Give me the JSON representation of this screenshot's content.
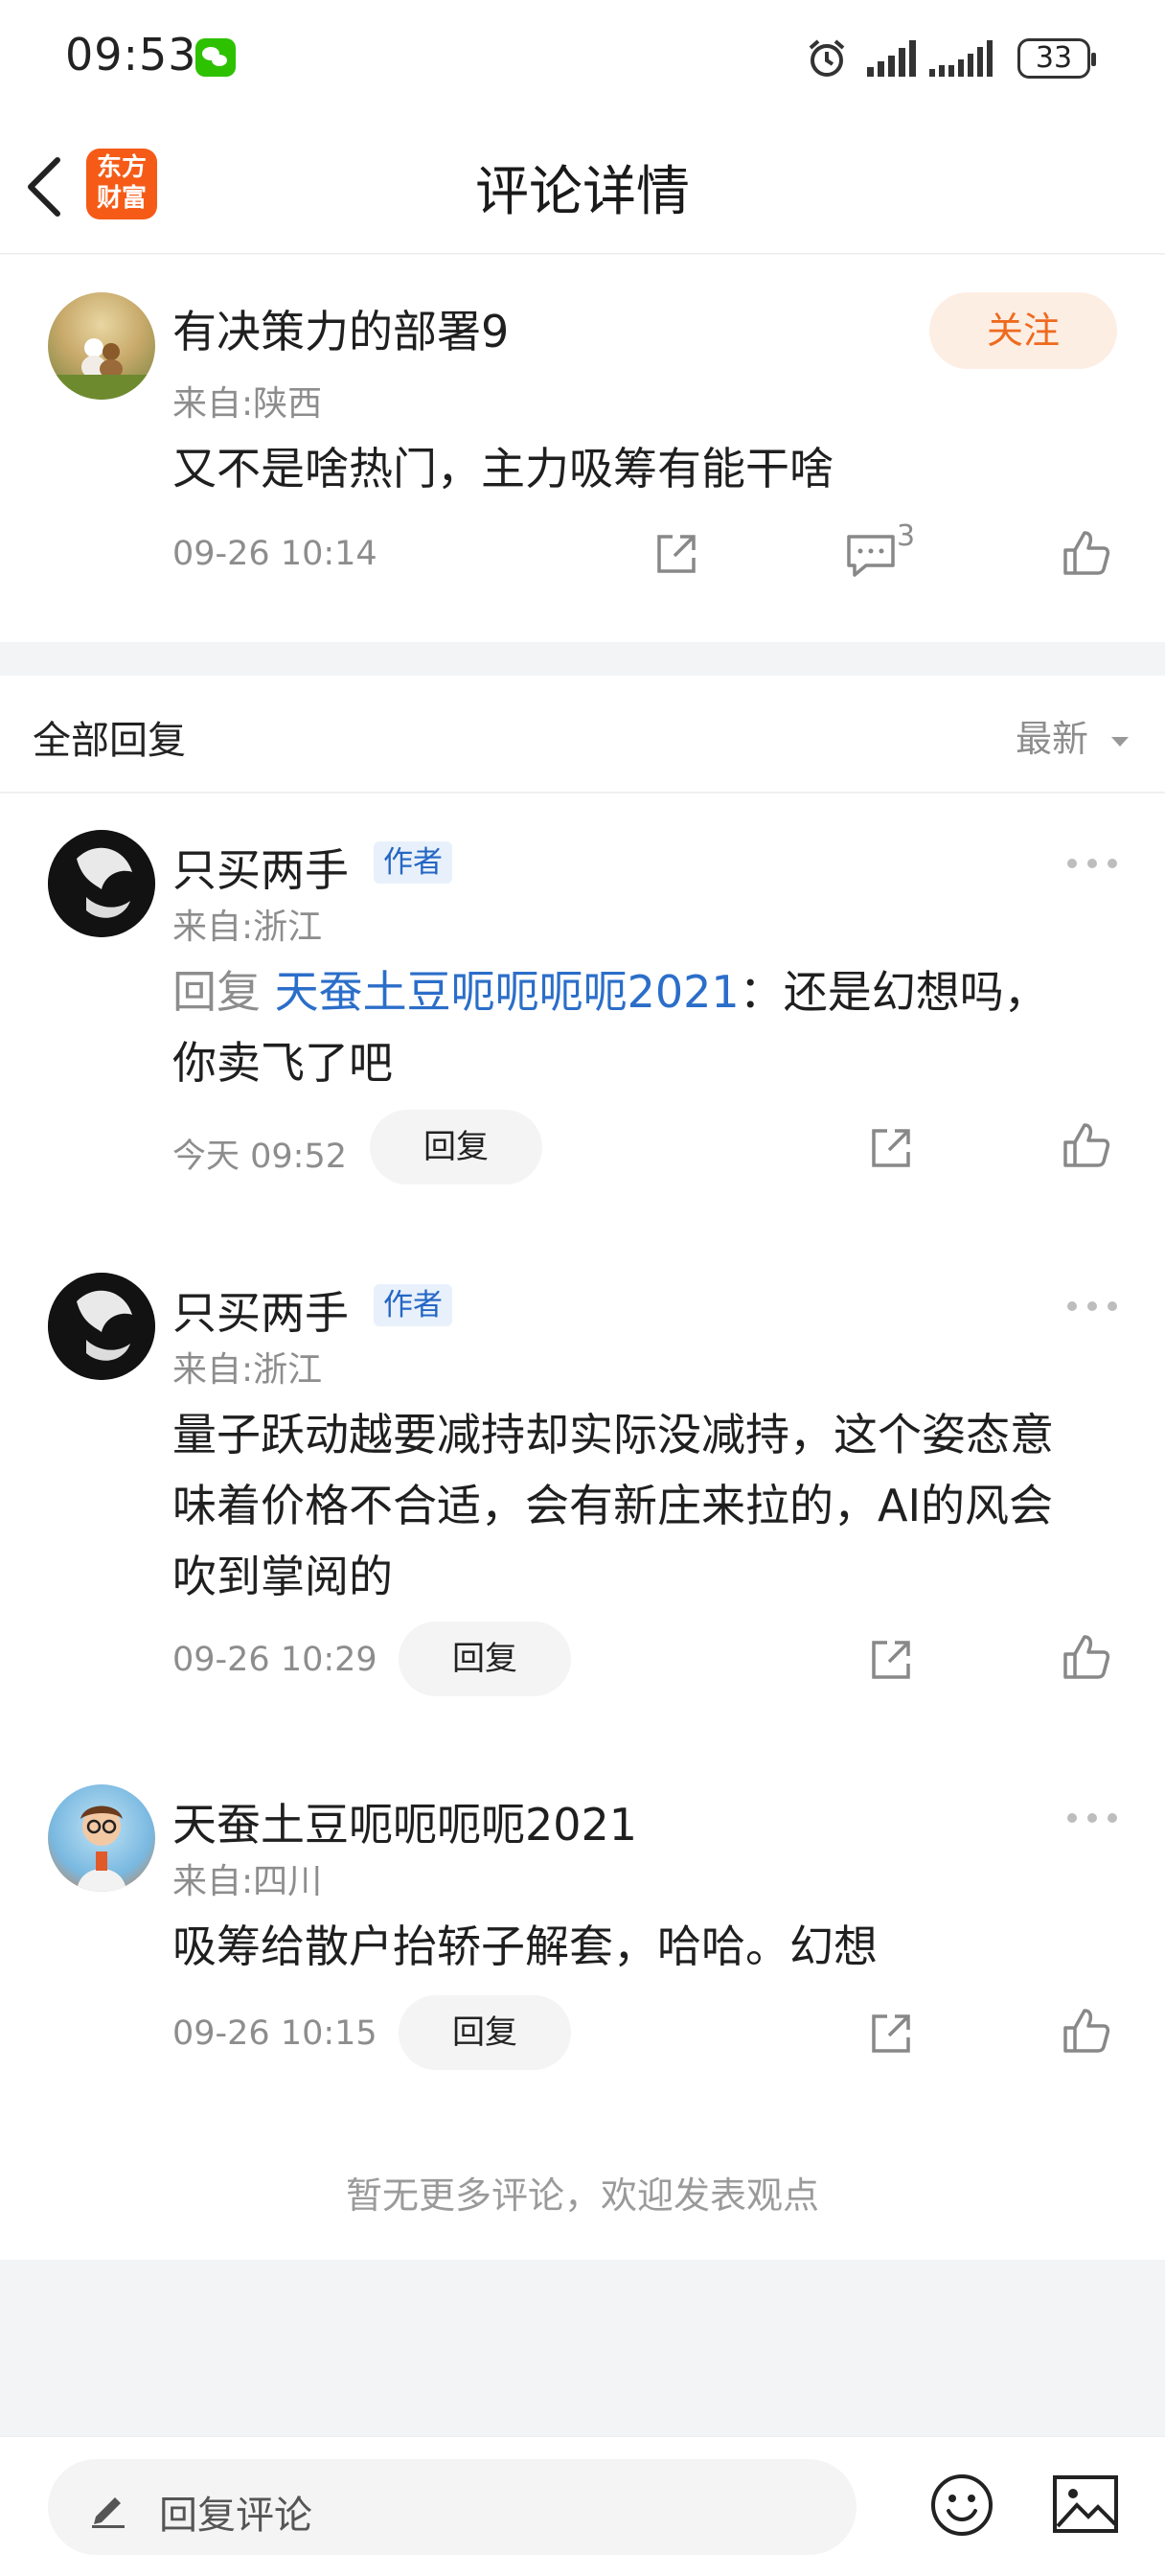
{
  "status_bar": {
    "time": "09:53",
    "battery": "33"
  },
  "header": {
    "title": "评论详情",
    "logo_text_line1": "东方",
    "logo_text_line2": "财富"
  },
  "main_post": {
    "username": "有决策力的部署9",
    "location": "来自:陕西",
    "content": "又不是啥热门，主力吸筹有能干啥",
    "timestamp": "09-26 10:14",
    "follow_label": "关注",
    "comment_count": "3"
  },
  "replies_header": {
    "title": "全部回复",
    "sort_label": "最新"
  },
  "replies": [
    {
      "username": "只买两手",
      "badge": "作者",
      "location": "来自:浙江",
      "reply_prefix": "回复",
      "reply_to": "天蚕土豆呃呃呃呃2021",
      "content_line1": "：还是幻想吗，",
      "content_line2": "你卖飞了吧",
      "timestamp": "今天 09:52",
      "reply_label": "回复"
    },
    {
      "username": "只买两手",
      "badge": "作者",
      "location": "来自:浙江",
      "content_line1": "量子跃动越要减持却实际没减持，这个姿态意",
      "content_line2": "味着价格不合适，会有新庄来拉的，AI的风会",
      "content_line3": "吹到掌阅的",
      "timestamp": "09-26 10:29",
      "reply_label": "回复"
    },
    {
      "username": "天蚕土豆呃呃呃呃2021",
      "location": "来自:四川",
      "content_line1": "吸筹给散户抬轿子解套，哈哈。幻想",
      "timestamp": "09-26 10:15",
      "reply_label": "回复"
    }
  ],
  "footer_note": "暂无更多评论，欢迎发表观点",
  "bottom_bar": {
    "input_placeholder": "回复评论"
  },
  "colors": {
    "brand": "#f55b17",
    "link": "#2b6ec9",
    "follow": "#ee6a1e"
  }
}
